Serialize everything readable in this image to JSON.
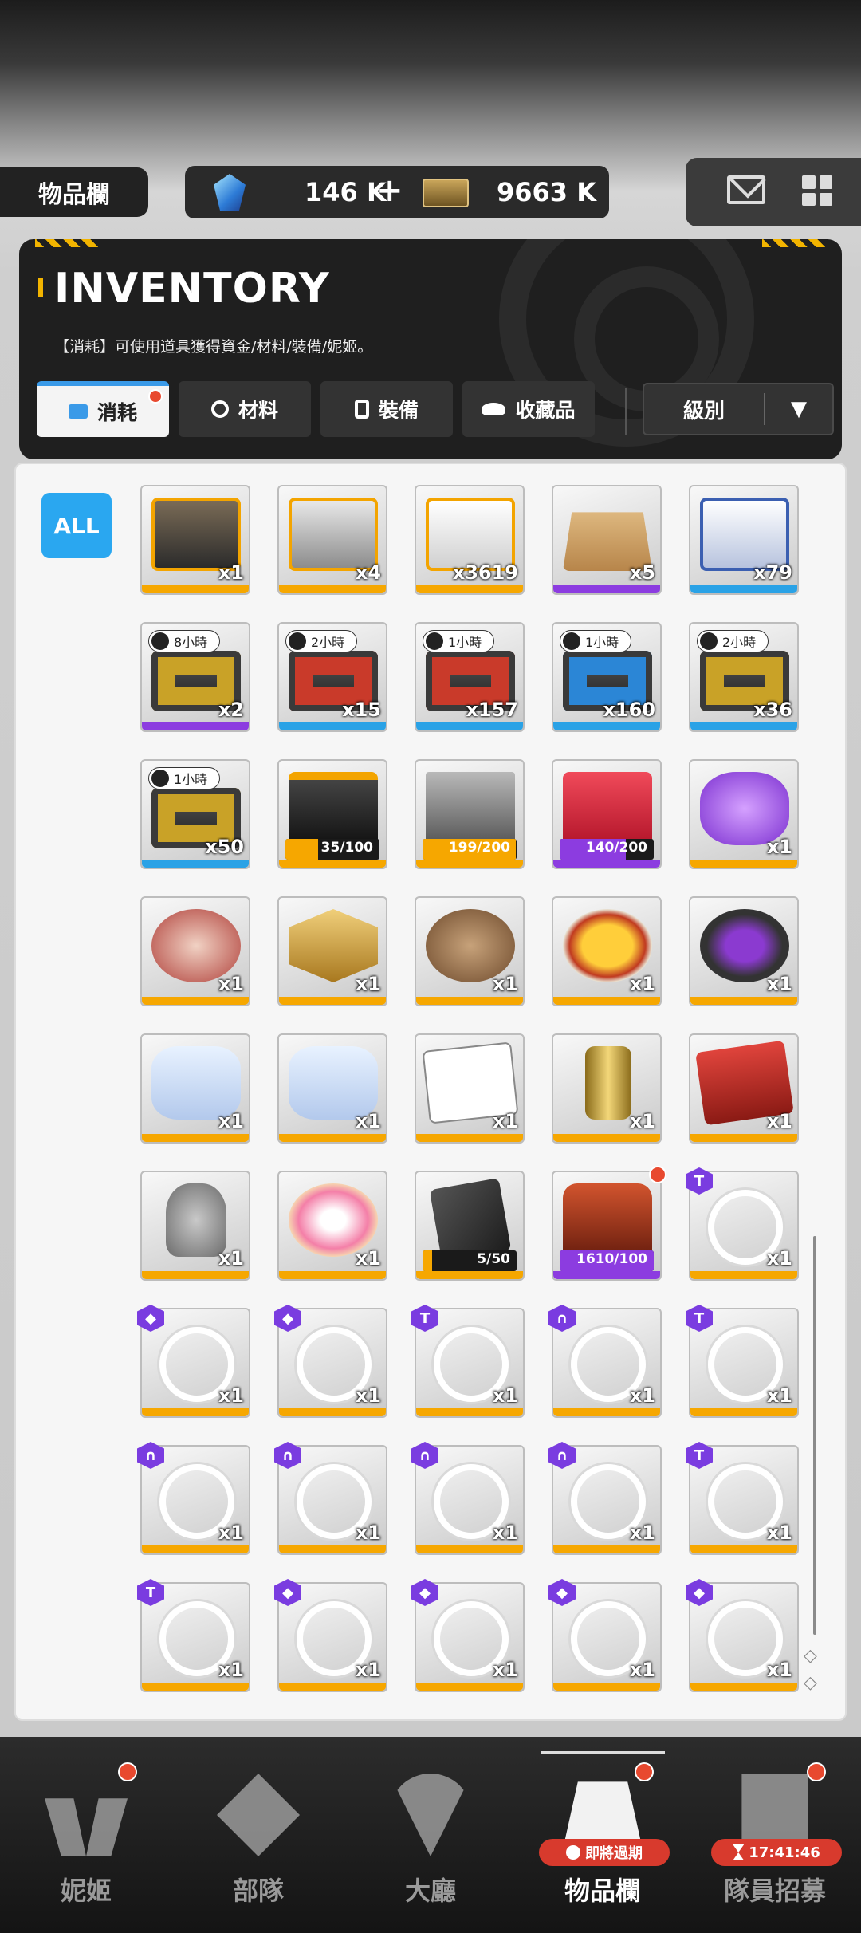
{
  "topbar": {
    "page_label": "物品欄",
    "gem_value": "146 K",
    "gem_plus": "+",
    "ticket_value": "9663 K",
    "icons": [
      "gem-icon",
      "ticket-icon",
      "mail-icon",
      "grid-menu-icon"
    ]
  },
  "header": {
    "title": "INVENTORY",
    "subtitle": "【消耗】可使用道具獲得資金/材料/裝備/妮姬。",
    "tabs": [
      {
        "label": "消耗",
        "active": true,
        "badge": true
      },
      {
        "label": "材料",
        "active": false
      },
      {
        "label": "裝備",
        "active": false
      },
      {
        "label": "收藏品",
        "active": false
      }
    ],
    "sort_label": "級別",
    "sort_arrow": "▼"
  },
  "filter": {
    "all_label": "ALL"
  },
  "items": [
    {
      "art": "crate-gold",
      "rarity": "ssr",
      "count": "x1"
    },
    {
      "art": "crate-silver",
      "rarity": "ssr",
      "count": "x4"
    },
    {
      "art": "crate-white",
      "rarity": "ssr",
      "count": "x3619"
    },
    {
      "art": "box-cardboard",
      "rarity": "sr",
      "count": "x5"
    },
    {
      "art": "crate-blue",
      "rarity": "r",
      "count": "x79"
    },
    {
      "art": "case gold-bars",
      "rarity": "sr",
      "count": "x2",
      "timer": "8小時"
    },
    {
      "art": "case red-bars",
      "rarity": "r",
      "count": "x15",
      "timer": "2小時"
    },
    {
      "art": "case red-bars",
      "rarity": "r",
      "count": "x157",
      "timer": "1小時"
    },
    {
      "art": "case blue-bars",
      "rarity": "r",
      "count": "x160",
      "timer": "1小時"
    },
    {
      "art": "case gold-bars",
      "rarity": "r",
      "count": "x36",
      "timer": "2小時"
    },
    {
      "art": "case gold-bars",
      "rarity": "r",
      "count": "x50",
      "timer": "1小時"
    },
    {
      "art": "chest-dark",
      "rarity": "ssr",
      "progress": "35/100",
      "progress_fraction": 0.35,
      "progress_color": "gold"
    },
    {
      "art": "cube-gray",
      "rarity": "ssr",
      "progress": "199/200",
      "progress_fraction": 0.995,
      "progress_color": "gold"
    },
    {
      "art": "lucky-box",
      "rarity": "sr",
      "progress": "140/200",
      "progress_fraction": 0.7,
      "progress_color": "purple"
    },
    {
      "art": "purple-cake",
      "rarity": "ssr",
      "count": "x1"
    },
    {
      "art": "cake-red",
      "rarity": "ssr",
      "count": "x1"
    },
    {
      "art": "medal-gold",
      "rarity": "ssr",
      "count": "x1"
    },
    {
      "art": "cake-choco",
      "rarity": "ssr",
      "count": "x1"
    },
    {
      "art": "omelet",
      "rarity": "ssr",
      "count": "x1"
    },
    {
      "art": "pot",
      "rarity": "ssr",
      "count": "x1"
    },
    {
      "art": "keychain",
      "rarity": "ssr",
      "count": "x1"
    },
    {
      "art": "keychain",
      "rarity": "ssr",
      "count": "x1"
    },
    {
      "art": "note",
      "rarity": "ssr",
      "count": "x1"
    },
    {
      "art": "can-gold",
      "rarity": "ssr",
      "count": "x1"
    },
    {
      "art": "book-red",
      "rarity": "ssr",
      "count": "x1"
    },
    {
      "art": "statue",
      "rarity": "ssr",
      "count": "x1"
    },
    {
      "art": "cake-pink",
      "rarity": "ssr",
      "count": "x1"
    },
    {
      "art": "dark-card",
      "rarity": "ssr",
      "progress": "5/50",
      "progress_fraction": 0.1,
      "progress_color": "gold"
    },
    {
      "art": "jacket-red",
      "rarity": "sr",
      "progress": "1610/100",
      "progress_fraction": 1,
      "progress_color": "purple",
      "badge": true
    },
    {
      "art": "portrait",
      "rarity": "ssr",
      "count": "x1",
      "corner": "T"
    },
    {
      "art": "portrait",
      "rarity": "ssr",
      "count": "x1",
      "corner": "◆"
    },
    {
      "art": "portrait",
      "rarity": "ssr",
      "count": "x1",
      "corner": "◆"
    },
    {
      "art": "portrait",
      "rarity": "ssr",
      "count": "x1",
      "corner": "T"
    },
    {
      "art": "portrait",
      "rarity": "ssr",
      "count": "x1",
      "corner": "∩"
    },
    {
      "art": "portrait",
      "rarity": "ssr",
      "count": "x1",
      "corner": "T"
    },
    {
      "art": "portrait",
      "rarity": "ssr",
      "count": "x1",
      "corner": "∩"
    },
    {
      "art": "portrait",
      "rarity": "ssr",
      "count": "x1",
      "corner": "∩"
    },
    {
      "art": "portrait",
      "rarity": "ssr",
      "count": "x1",
      "corner": "∩"
    },
    {
      "art": "portrait",
      "rarity": "ssr",
      "count": "x1",
      "corner": "∩"
    },
    {
      "art": "portrait",
      "rarity": "ssr",
      "count": "x1",
      "corner": "T"
    },
    {
      "art": "portrait",
      "rarity": "ssr",
      "count": "x1",
      "corner": "T"
    },
    {
      "art": "portrait",
      "rarity": "ssr",
      "count": "x1",
      "corner": "◆"
    },
    {
      "art": "portrait",
      "rarity": "ssr",
      "count": "x1",
      "corner": "◆"
    },
    {
      "art": "portrait",
      "rarity": "ssr",
      "count": "x1",
      "corner": "◆"
    },
    {
      "art": "portrait",
      "rarity": "ssr",
      "count": "x1",
      "corner": "◆"
    }
  ],
  "scroll": {
    "arrows": "◇\n◇"
  },
  "nav": [
    {
      "label": "妮姬",
      "icon": "people-icon",
      "dot": true
    },
    {
      "label": "部隊",
      "icon": "squad-icon",
      "dot": false
    },
    {
      "label": "大廳",
      "icon": "lobby-icon",
      "dot": false
    },
    {
      "label": "物品欄",
      "icon": "inventory-icon",
      "dot": true,
      "active": true,
      "pill": "即將過期"
    },
    {
      "label": "隊員招募",
      "icon": "recruit-icon",
      "dot": true,
      "pill": "17:41:46"
    }
  ],
  "colors": {
    "accent_blue": "#2aa7f0",
    "rarity_ssr": "#f6a700",
    "rarity_sr": "#8c3ce0",
    "rarity_r": "#2aa2e6",
    "alert_red": "#e8492f"
  }
}
